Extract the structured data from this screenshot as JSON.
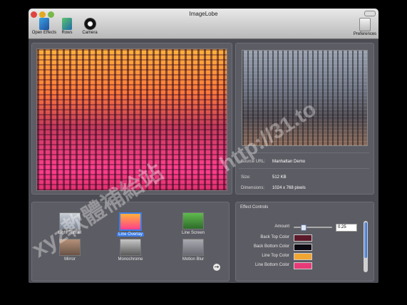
{
  "window": {
    "title": "ImageLobe"
  },
  "toolbar": {
    "open_effects": "Open Effects",
    "rows": "Rows",
    "camera": "Camera",
    "preferences": "Preferences"
  },
  "info": {
    "source_url_label": "Source URL:",
    "source_url_value": "Manhattan Demo",
    "size_label": "Size:",
    "size_value": "512 KB",
    "dimensions_label": "Dimensions:",
    "dimensions_value": "1024 x 768 pixels"
  },
  "effects": [
    {
      "name": "Light Tunnel",
      "icon": "light-tunnel-thumb",
      "selected": false
    },
    {
      "name": "Line Overlay",
      "icon": "line-overlay-thumb",
      "selected": true
    },
    {
      "name": "Line Screen",
      "icon": "line-screen-thumb",
      "selected": false
    },
    {
      "name": "Mirror",
      "icon": "mirror-thumb",
      "selected": false
    },
    {
      "name": "Monochrome",
      "icon": "monochrome-thumb",
      "selected": false
    },
    {
      "name": "Motion Blur",
      "icon": "motion-blur-thumb",
      "selected": false
    }
  ],
  "controls": {
    "title": "Effect Controls",
    "amount_label": "Amount",
    "amount_value": "0.25",
    "amount_fraction": 0.25,
    "back_top_label": "Back Top Color",
    "back_top_color": "#5c1a2a",
    "back_bottom_label": "Back Bottom Color",
    "back_bottom_color": "#0d0a14",
    "line_top_label": "Line Top Color",
    "line_top_color": "#f2a632",
    "line_bottom_label": "Line Bottom Color",
    "line_bottom_color": "#e83a78"
  },
  "watermark": {
    "main": "xyz軟體補給站",
    "url": "http://31.to"
  }
}
